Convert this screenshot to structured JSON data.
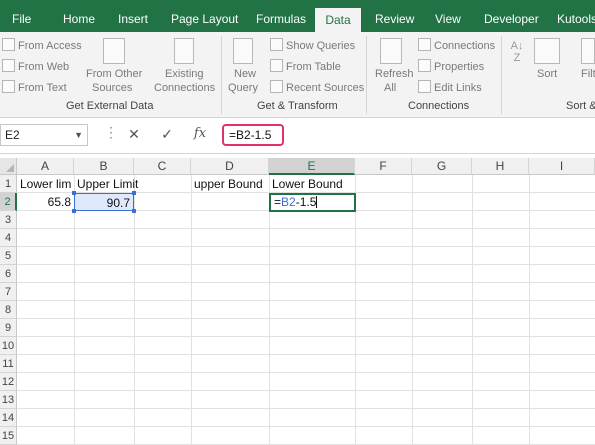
{
  "ribbon_tabs": [
    {
      "label": "File",
      "active": false
    },
    {
      "label": "Home",
      "active": false
    },
    {
      "label": "Insert",
      "active": false
    },
    {
      "label": "Page Layout",
      "active": false
    },
    {
      "label": "Formulas",
      "active": false
    },
    {
      "label": "Data",
      "active": true
    },
    {
      "label": "Review",
      "active": false
    },
    {
      "label": "View",
      "active": false
    },
    {
      "label": "Developer",
      "active": false
    },
    {
      "label": "Kutools",
      "active": false
    }
  ],
  "ribbon": {
    "get_external_data": {
      "label": "Get External Data",
      "from_access": "From Access",
      "from_web": "From Web",
      "from_text": "From Text",
      "from_other_sources_1": "From Other",
      "from_other_sources_2": "Sources",
      "existing_connections_1": "Existing",
      "existing_connections_2": "Connections"
    },
    "get_transform": {
      "label": "Get & Transform",
      "new_query_1": "New",
      "new_query_2": "Query",
      "show_queries": "Show Queries",
      "from_table": "From Table",
      "recent_sources": "Recent Sources"
    },
    "connections": {
      "label": "Connections",
      "refresh_all_1": "Refresh",
      "refresh_all_2": "All",
      "connections": "Connections",
      "properties": "Properties",
      "edit_links": "Edit Links"
    },
    "sort_filter": {
      "label": "Sort &",
      "sort": "Sort",
      "filter": "Filt"
    }
  },
  "formula_bar": {
    "name_box": "E2",
    "cancel_glyph": "✕",
    "enter_glyph": "✓",
    "fx_glyph": "fx",
    "formula": "=B2-1.5"
  },
  "grid": {
    "columns": [
      "A",
      "B",
      "C",
      "D",
      "E",
      "F",
      "G",
      "H",
      "I"
    ],
    "rows": [
      "1",
      "2",
      "3",
      "4",
      "5",
      "6",
      "7",
      "8",
      "9",
      "10",
      "11",
      "12",
      "13",
      "14",
      "15"
    ],
    "selected_column": "E",
    "selected_row": "2",
    "cells": {
      "A1": "Lower lim",
      "B1": "Upper Limit",
      "D1": "upper Bound",
      "E1": "Lower Bound",
      "A2": "65.8",
      "B2": "90.7",
      "E2_prefix": "=",
      "E2_ref": "B2",
      "E2_suffix": "-1.5"
    }
  },
  "colors": {
    "accent": "#217346",
    "highlight_box": "#e0316b",
    "reference": "#3a6fd8"
  }
}
